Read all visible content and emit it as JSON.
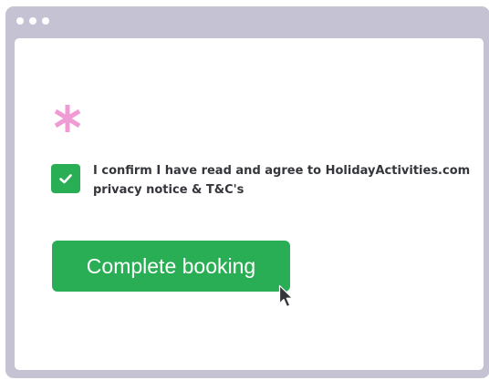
{
  "colors": {
    "window_chrome": "#c5c3d3",
    "background": "#ffffff",
    "accent_green": "#2aae55",
    "asterisk_pink": "#f19bd4",
    "text_dark": "#34363c"
  },
  "window": {
    "controls": [
      "dot",
      "dot",
      "dot"
    ]
  },
  "form": {
    "required_marker": "*",
    "consent": {
      "checked": true,
      "label_line1": "I confirm I have read and agree to HolidayActivities.com",
      "label_line2": "privacy notice & T&C's"
    },
    "submit_label": "Complete booking"
  },
  "icons": {
    "required": "asterisk-icon",
    "check": "checkmark-icon",
    "pointer": "mouse-cursor-icon"
  }
}
